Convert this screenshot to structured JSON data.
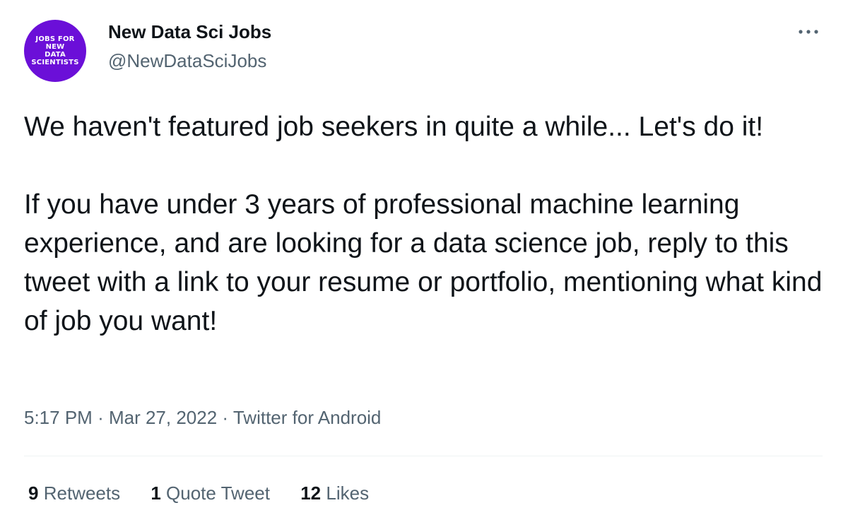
{
  "account": {
    "avatar_lines": [
      "JOBS FOR",
      "NEW",
      "DATA",
      "SCIENTISTS"
    ],
    "display_name": "New Data Sci Jobs",
    "handle": "@NewDataSciJobs"
  },
  "more_icon": "more-horizontal-icon",
  "tweet": {
    "paragraphs": [
      "We haven't featured job seekers in quite a while... Let's do it!",
      "If you have under 3 years of professional machine learning experience, and are looking for a data science job, reply to this tweet with a link to your resume or portfolio, mentioning what kind of job you want!"
    ]
  },
  "meta": {
    "time": "5:17 PM",
    "separator": "·",
    "date": "Mar 27, 2022",
    "source": "Twitter for Android"
  },
  "stats": {
    "retweets": {
      "count": "9",
      "label": "Retweets"
    },
    "quotes": {
      "count": "1",
      "label": "Quote Tweet"
    },
    "likes": {
      "count": "12",
      "label": "Likes"
    }
  },
  "colors": {
    "avatar_bg": "#6b0fd8",
    "text_primary": "#0f1419",
    "text_secondary": "#536471",
    "divider": "#eff3f4"
  }
}
